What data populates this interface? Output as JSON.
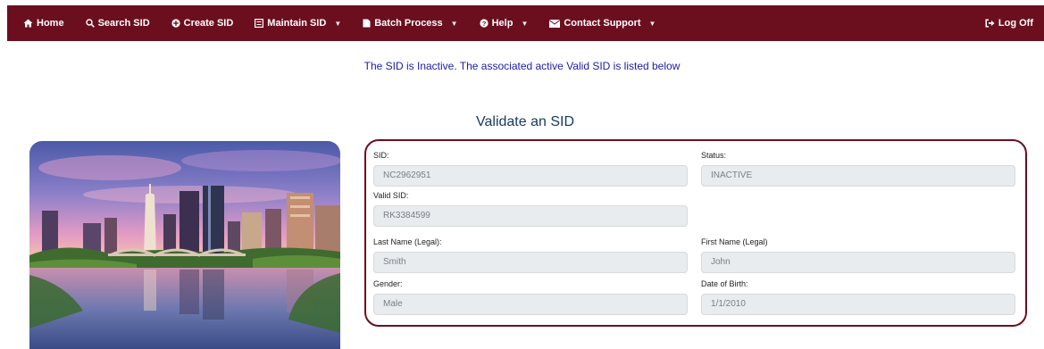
{
  "nav": {
    "home": "Home",
    "search_sid": "Search SID",
    "create_sid": "Create SID",
    "maintain_sid": "Maintain SID",
    "batch_process": "Batch Process",
    "help": "Help",
    "contact_support": "Contact Support",
    "log_off": "Log Off"
  },
  "notice": "The SID is Inactive. The associated active Valid SID is listed below",
  "page_title": "Validate an SID",
  "form": {
    "sid_label": "SID:",
    "sid_value": "NC2962951",
    "status_label": "Status:",
    "status_value": "INACTIVE",
    "valid_sid_label": "Valid SID:",
    "valid_sid_value": "RK3384599",
    "last_name_label": "Last Name (Legal):",
    "last_name_value": "Smith",
    "first_name_label": "First Name (Legal)",
    "first_name_value": "John",
    "gender_label": "Gender:",
    "gender_value": "Male",
    "dob_label": "Date of Birth:",
    "dob_value": "1/1/2010"
  },
  "colors": {
    "navbar": "#6b0f1f",
    "notice_text": "#1c1ca8",
    "title_text": "#163a5f",
    "card_border": "#6b0f1f"
  },
  "icons": [
    "home-icon",
    "search-icon",
    "plus-circle-icon",
    "list-icon",
    "file-icon",
    "question-icon",
    "envelope-icon",
    "logoff-icon"
  ]
}
